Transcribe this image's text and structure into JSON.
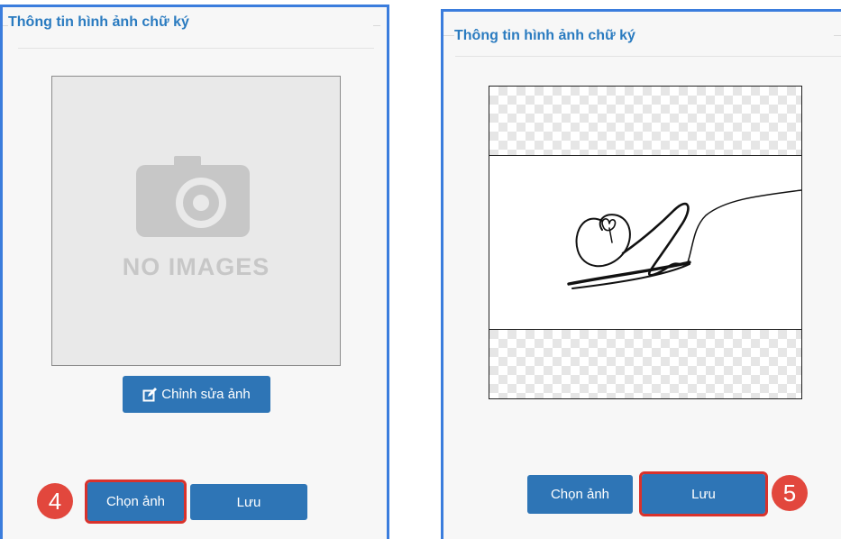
{
  "left_panel": {
    "title": "Thông tin hình ảnh chữ ký",
    "placeholder_text": "NO IMAGES",
    "edit_button": "Chỉnh sửa ảnh",
    "choose_button": "Chọn ảnh",
    "save_button": "Lưu",
    "step_badge": "4"
  },
  "right_panel": {
    "title": "Thông tin hình ảnh chữ ký",
    "choose_button": "Chọn ảnh",
    "save_button": "Lưu",
    "step_badge": "5"
  },
  "colors": {
    "button": "#2e75b6",
    "highlight": "#d9322c",
    "badge": "#e2473d",
    "title": "#2a7bc0",
    "panel_border": "#3b7ddd"
  },
  "icons": [
    "camera-icon",
    "edit-icon",
    "signature-image"
  ]
}
